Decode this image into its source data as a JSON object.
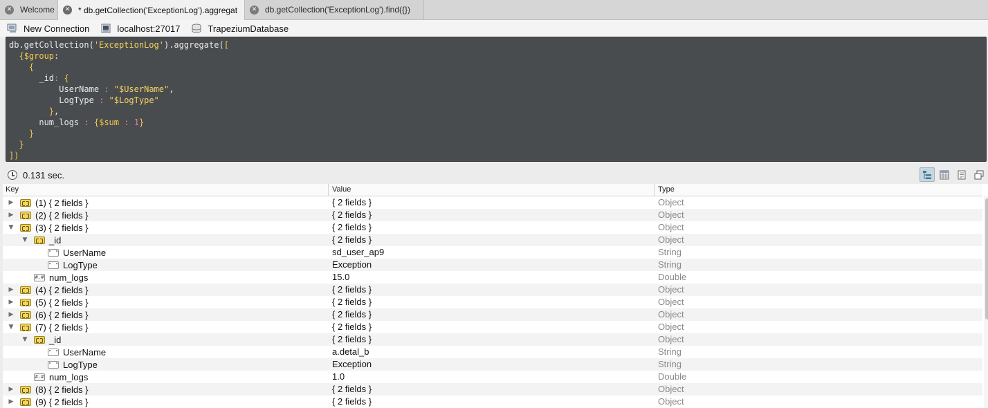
{
  "tabs": [
    {
      "label": "Welcome",
      "active": false
    },
    {
      "label": "* db.getCollection('ExceptionLog').aggregat",
      "active": true
    },
    {
      "label": "db.getCollection('ExceptionLog').find({})",
      "active": false
    }
  ],
  "connection": {
    "new_connection": "New Connection",
    "server": "localhost:27017",
    "database": "TrapeziumDatabase"
  },
  "editor": {
    "lines": [
      "db.getCollection('ExceptionLog').aggregate([",
      "  {$group:",
      "    {",
      "      _id: {",
      "          UserName : \"$UserName\",",
      "          LogType : \"$LogType\"",
      "        },",
      "      num_logs : {$sum : 1}",
      "    }",
      "  }",
      "])"
    ]
  },
  "status": {
    "time": "0.131 sec."
  },
  "columns": {
    "key": "Key",
    "value": "Value",
    "type": "Type"
  },
  "rows": [
    {
      "depth": 0,
      "arrow": "right",
      "icon": "object",
      "key": "(1) { 2 fields }",
      "value": "{ 2 fields }",
      "type": "Object"
    },
    {
      "depth": 0,
      "arrow": "right",
      "icon": "object",
      "key": "(2) { 2 fields }",
      "value": "{ 2 fields }",
      "type": "Object"
    },
    {
      "depth": 0,
      "arrow": "down",
      "icon": "object",
      "key": "(3) { 2 fields }",
      "value": "{ 2 fields }",
      "type": "Object"
    },
    {
      "depth": 1,
      "arrow": "down",
      "icon": "object",
      "key": "_id",
      "value": "{ 2 fields }",
      "type": "Object"
    },
    {
      "depth": 2,
      "arrow": "none",
      "icon": "string",
      "key": "UserName",
      "value": "sd_user_ap9",
      "type": "String"
    },
    {
      "depth": 2,
      "arrow": "none",
      "icon": "string",
      "key": "LogType",
      "value": "Exception",
      "type": "String"
    },
    {
      "depth": 1,
      "arrow": "none",
      "icon": "number",
      "key": "num_logs",
      "value": "15.0",
      "type": "Double"
    },
    {
      "depth": 0,
      "arrow": "right",
      "icon": "object",
      "key": "(4) { 2 fields }",
      "value": "{ 2 fields }",
      "type": "Object"
    },
    {
      "depth": 0,
      "arrow": "right",
      "icon": "object",
      "key": "(5) { 2 fields }",
      "value": "{ 2 fields }",
      "type": "Object"
    },
    {
      "depth": 0,
      "arrow": "right",
      "icon": "object",
      "key": "(6) { 2 fields }",
      "value": "{ 2 fields }",
      "type": "Object"
    },
    {
      "depth": 0,
      "arrow": "down",
      "icon": "object",
      "key": "(7) { 2 fields }",
      "value": "{ 2 fields }",
      "type": "Object"
    },
    {
      "depth": 1,
      "arrow": "down",
      "icon": "object",
      "key": "_id",
      "value": "{ 2 fields }",
      "type": "Object"
    },
    {
      "depth": 2,
      "arrow": "none",
      "icon": "string",
      "key": "UserName",
      "value": "a.detal_b",
      "type": "String"
    },
    {
      "depth": 2,
      "arrow": "none",
      "icon": "string",
      "key": "LogType",
      "value": "Exception",
      "type": "String"
    },
    {
      "depth": 1,
      "arrow": "none",
      "icon": "number",
      "key": "num_logs",
      "value": "1.0",
      "type": "Double"
    },
    {
      "depth": 0,
      "arrow": "right",
      "icon": "object",
      "key": "(8) { 2 fields }",
      "value": "{ 2 fields }",
      "type": "Object"
    },
    {
      "depth": 0,
      "arrow": "right",
      "icon": "object",
      "key": "(9) { 2 fields }",
      "value": "{ 2 fields }",
      "type": "Object"
    }
  ],
  "colors": {
    "editor_bg": "#494c4f",
    "string_token": "#f4d35e",
    "number_token": "#e07fa3",
    "type_text": "#8a8a8a",
    "object_icon": "#f1d55e"
  }
}
